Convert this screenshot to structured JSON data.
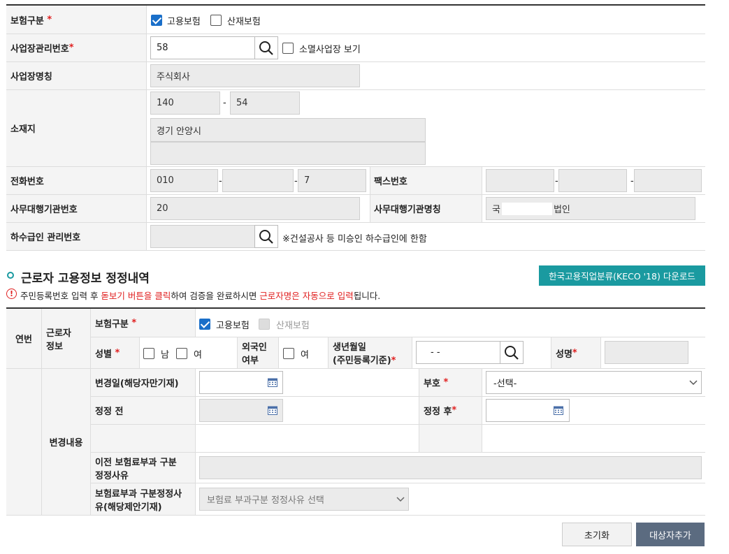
{
  "employer": {
    "insurance_type_label": "보험구분",
    "insurance_options": [
      {
        "label": "고용보험",
        "checked": true
      },
      {
        "label": "산재보험",
        "checked": false
      }
    ],
    "biz_mgmt_no_label": "사업장관리번호",
    "biz_mgmt_no_value": "58",
    "closed_biz_label": "소멸사업장 보기",
    "biz_name_label": "사업장명칭",
    "biz_name_value": "주식회사",
    "location_label": "소재지",
    "zip1": "140",
    "zip_sep": "-",
    "zip2": "54",
    "address1": "경기 안양시",
    "address2": "",
    "phone_label": "전화번호",
    "phone1": "010",
    "phone2": "",
    "phone3": "7",
    "fax_label": "팩스번호",
    "agency_no_label": "사무대행기관번호",
    "agency_no_value": "20",
    "agency_name_label": "사무대행기관명칭",
    "agency_name_prefix": "국",
    "agency_name_suffix": "법인",
    "subcontractor_label": "하수급인 관리번호",
    "subcontractor_note": "※건설공사 등 미승인 하수급인에 한함"
  },
  "section": {
    "title": "근로자 고용정보 정정내역",
    "download_button": "한국고용직업분류(KECO '18) 다운로드",
    "notice_a": "주민등록번호 입력 후 ",
    "notice_b": "돋보기 버튼을 클릭",
    "notice_c": "하여 검증을 완료하시면 ",
    "notice_d": "근로자명은 자동으로 입력",
    "notice_e": "됩니다."
  },
  "worker": {
    "seq_label": "연번",
    "info_label_1": "근로자",
    "info_label_2": "정보",
    "insurance_label": "보험구분",
    "ins_employment": "고용보험",
    "ins_industrial": "산재보험",
    "gender_label": "성별",
    "gender_male": "남",
    "gender_female": "여",
    "foreigner_label_1": "외국인",
    "foreigner_label_2": "여부",
    "foreigner_yes": "여",
    "birth_label_1": "생년월일",
    "birth_label_2": "(주민등록기준)",
    "birth_value": "- -",
    "name_label": "성명"
  },
  "change": {
    "group_label": "변경내용",
    "change_date_label": "변경일(해당자만기재)",
    "code_label": "부호",
    "code_value": "-선택-",
    "before_label": "정정 전",
    "after_label": "정정 후",
    "prev_reason_label_1": "이전 보험료부과 구분",
    "prev_reason_label_2": "정정사유",
    "reason_label_1": "보험료부과 구분정정사",
    "reason_label_2": "유(해당제안기재)",
    "reason_placeholder": "보험료 부과구분 정정사유 선택"
  },
  "buttons": {
    "reset": "초기화",
    "add": "대상자추가"
  },
  "colors": {
    "accent": "#1a9aa0",
    "add_btn": "#5b6b80",
    "required": "#e02020",
    "check": "#1a6fc9"
  }
}
